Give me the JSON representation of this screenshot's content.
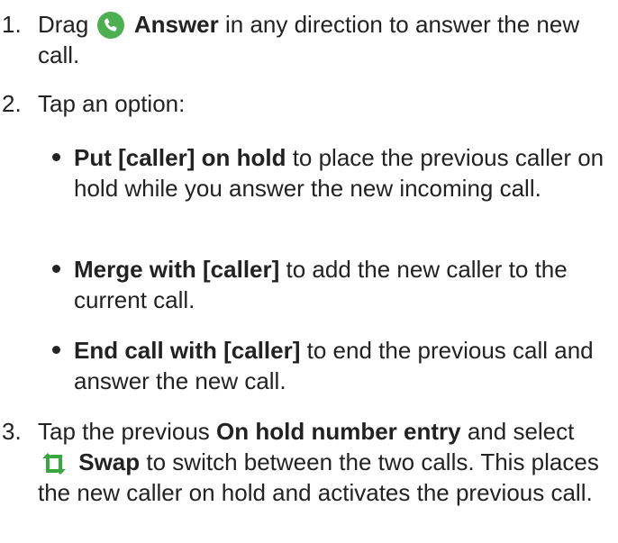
{
  "steps": [
    {
      "number": "1.",
      "text_before_icon": "Drag",
      "icon": "phone-answer-icon",
      "bold": "Answer",
      "text_after": "in any direction to answer the new call."
    },
    {
      "number": "2.",
      "text": "Tap an option:",
      "options": [
        {
          "bold": "Put [caller] on hold",
          "text": "to place the previous caller on hold while you answer the new incoming call."
        },
        {
          "bold": "Merge with [caller]",
          "text": "to add the new caller to the current call."
        },
        {
          "bold": "End call with [caller]",
          "text": "to end the previous call and answer the new call."
        }
      ]
    },
    {
      "number": "3.",
      "text_before": "Tap the previous",
      "bold_entry": "On hold number entry",
      "text_and_select": "and select",
      "icon": "swap-icon",
      "bold_swap": "Swap",
      "text_after": "to switch between the two calls. This places the new caller on hold and activates the previous call."
    }
  ],
  "colors": {
    "text": "#222222",
    "answer_icon": "#4caf50",
    "swap_icon": "#35a840"
  }
}
